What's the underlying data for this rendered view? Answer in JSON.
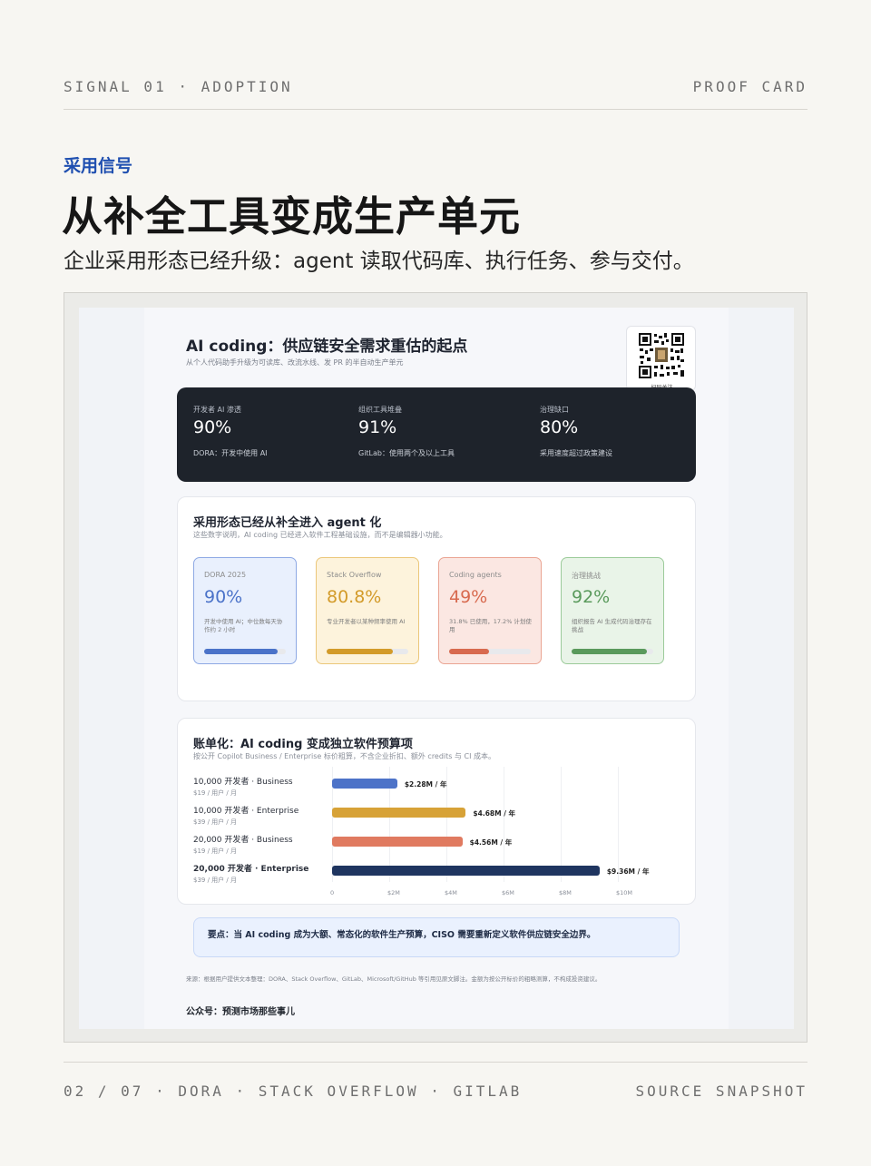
{
  "header": {
    "left": "SIGNAL 01 · ADOPTION",
    "right": "PROOF CARD"
  },
  "kicker": "采用信号",
  "headline": "从补全工具变成生产单元",
  "subline": "企业采用形态已经升级：agent 读取代码库、执行任务、参与交付。",
  "screenshot": {
    "title": "AI coding：供应链安全需求重估的起点",
    "subtitle": "从个人代码助手升级为可读库、改流水线、发 PR 的半自动生产单元",
    "qr_label": "扫码关注",
    "stats": [
      {
        "label": "开发者 AI 渗透",
        "value": "90%",
        "note": "DORA：开发中使用 AI"
      },
      {
        "label": "组织工具堆叠",
        "value": "91%",
        "note": "GitLab：使用两个及以上工具"
      },
      {
        "label": "治理缺口",
        "value": "80%",
        "note": "采用速度超过政策建设"
      }
    ],
    "adoption": {
      "title": "采用形态已经从补全进入 agent 化",
      "subtitle": "这些数字说明，AI coding 已经进入软件工程基础设施，而不是编辑器小功能。",
      "tiles": [
        {
          "label": "DORA 2025",
          "value": "90%",
          "note": "开发中使用 AI；中位数每天协作约 2 小时",
          "level": 0.9,
          "color": "#4b73c9",
          "bg": "#e9f0fd",
          "border": "#8ea9e4"
        },
        {
          "label": "Stack Overflow",
          "value": "80.8%",
          "note": "专业开发者以某种频率使用 AI",
          "level": 0.808,
          "color": "#d39b2a",
          "bg": "#fdf3dc",
          "border": "#ebc77a"
        },
        {
          "label": "Coding agents",
          "value": "49%",
          "note": "31.8% 已使用，17.2% 计划使用",
          "level": 0.49,
          "color": "#d86a4f",
          "bg": "#fbe7e2",
          "border": "#eaa593"
        },
        {
          "label": "治理挑战",
          "value": "92%",
          "note": "组织报告 AI 生成代码治理存在挑战",
          "level": 0.92,
          "color": "#5a9a5c",
          "bg": "#e9f4e8",
          "border": "#9ccb9a"
        }
      ]
    },
    "budget": {
      "title": "账单化：AI coding 变成独立软件预算项",
      "subtitle": "按公开 Copilot Business / Enterprise 标价粗算，不含企业折扣、额外 credits 与 CI 成本。",
      "rows": [
        {
          "label": "10,000 开发者 · Business",
          "price": "$19 / 用户 / 月",
          "value": 2.28,
          "value_label": "$2.28M / 年",
          "color": "#4d73c8",
          "bold": false
        },
        {
          "label": "10,000 开发者 · Enterprise",
          "price": "$39 / 用户 / 月",
          "value": 4.68,
          "value_label": "$4.68M / 年",
          "color": "#d7a237",
          "bold": false
        },
        {
          "label": "20,000 开发者 · Business",
          "price": "$19 / 用户 / 月",
          "value": 4.56,
          "value_label": "$4.56M / 年",
          "color": "#e07a60",
          "bold": false
        },
        {
          "label": "20,000 开发者 · Enterprise",
          "price": "$39 / 用户 / 月",
          "value": 9.36,
          "value_label": "$9.36M / 年",
          "color": "#1f3560",
          "bold": true
        }
      ],
      "ticks": [
        "0",
        "$2M",
        "$4M",
        "$6M",
        "$8M",
        "$10M"
      ],
      "xlim": [
        0,
        10
      ]
    },
    "callout": "要点：当 AI coding 成为大额、常态化的软件生产预算，CISO 需要重新定义软件供应链安全边界。",
    "source": "来源：根据用户提供文本整理：DORA、Stack Overflow、GitLab、Microsoft/GitHub 等引用见原文脚注。金额为按公开标价的粗略测算，不构成投资建议。",
    "account": "公众号：预测市场那些事儿"
  },
  "footer": {
    "left": "02 / 07 · DORA · STACK OVERFLOW · GITLAB",
    "right": "SOURCE SNAPSHOT"
  }
}
